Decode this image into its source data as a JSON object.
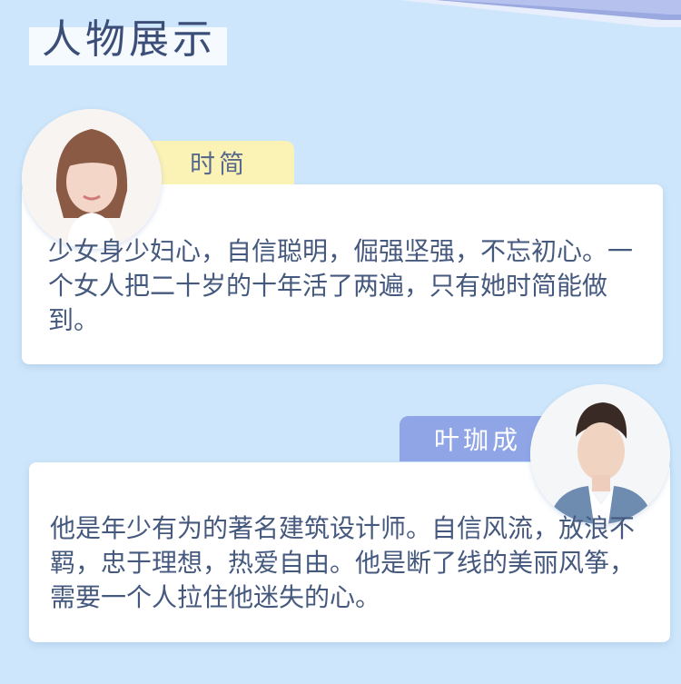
{
  "section_title": "人物展示",
  "characters": [
    {
      "name": "时简",
      "description": "少女身少妇心，自信聪明，倔强坚强，不忘初心。一个女人把二十岁的十年活了两遍，只有她时简能做到。",
      "tag_color": "#fbf2b6",
      "tag_text_color": "#5a6a8c"
    },
    {
      "name": "叶珈成",
      "description": "他是年少有为的著名建筑设计师。自信风流，放浪不羁，忠于理想，热爱自由。他是断了线的美丽风筝，需要一个人拉住他迷失的心。",
      "tag_color": "#8fa5e6",
      "tag_text_color": "#ffffff"
    }
  ]
}
